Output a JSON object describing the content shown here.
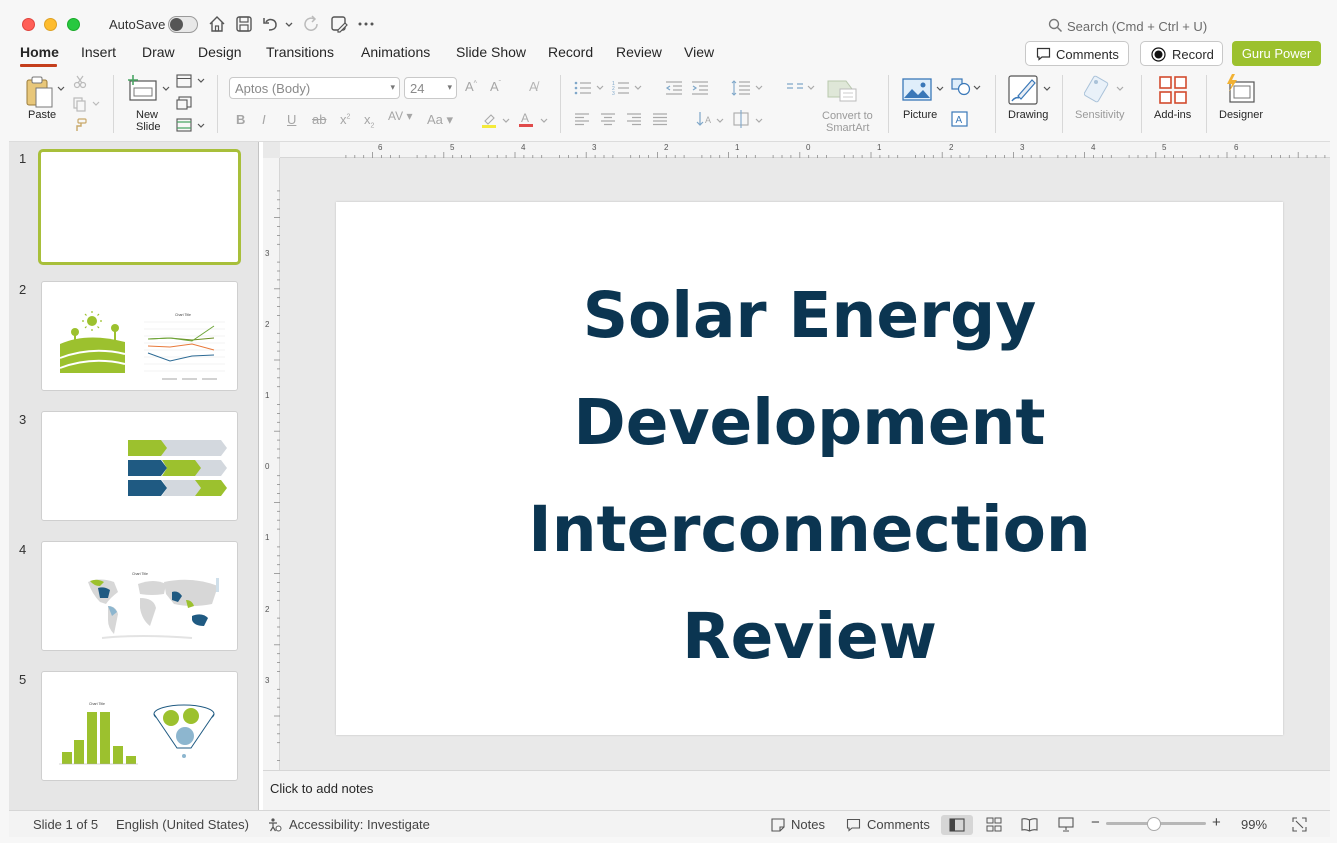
{
  "titlebar": {
    "autosave_label": "AutoSave",
    "search_placeholder": "Search (Cmd + Ctrl + U)"
  },
  "tabs": [
    {
      "label": "Home",
      "active": true
    },
    {
      "label": "Insert"
    },
    {
      "label": "Draw"
    },
    {
      "label": "Design"
    },
    {
      "label": "Transitions"
    },
    {
      "label": "Animations"
    },
    {
      "label": "Slide Show"
    },
    {
      "label": "Record"
    },
    {
      "label": "Review"
    },
    {
      "label": "View"
    }
  ],
  "header_buttons": {
    "comments": "Comments",
    "record": "Record",
    "guru": "Guru Power"
  },
  "ribbon": {
    "paste": "Paste",
    "new_slide_line1": "New",
    "new_slide_line2": "Slide",
    "font_name": "Aptos (Body)",
    "font_size": "24",
    "convert_line1": "Convert to",
    "convert_line2": "SmartArt",
    "picture": "Picture",
    "drawing": "Drawing",
    "sensitivity": "Sensitivity",
    "addins": "Add-ins",
    "designer": "Designer"
  },
  "ruler": {
    "horizontal": [
      "6",
      "5",
      "4",
      "3",
      "2",
      "1",
      "0",
      "1",
      "2",
      "3",
      "4",
      "5",
      "6"
    ],
    "vertical": [
      "3",
      "2",
      "1",
      "0",
      "1",
      "2",
      "3"
    ]
  },
  "thumbnails": [
    {
      "number": "1",
      "selected": true
    },
    {
      "number": "2",
      "chart_title": "Chart Title"
    },
    {
      "number": "3"
    },
    {
      "number": "4",
      "chart_title": "Chart Title"
    },
    {
      "number": "5",
      "chart_title": "Chart Title"
    }
  ],
  "slide": {
    "title_lines": [
      "Solar Energy",
      "Development",
      "Interconnection",
      "Review"
    ]
  },
  "notes": {
    "placeholder": "Click to add notes"
  },
  "status": {
    "slide_counter": "Slide 1 of 5",
    "language": "English (United States)",
    "accessibility": "Accessibility: Investigate",
    "notes": "Notes",
    "comments": "Comments",
    "zoom": "99%"
  },
  "colors": {
    "accent_green": "#9cc12e",
    "title_navy": "#0b3551",
    "tab_underline": "#c43e1c",
    "thumb_navy": "#1f5a82",
    "thumb_gray": "#d3d8de"
  }
}
